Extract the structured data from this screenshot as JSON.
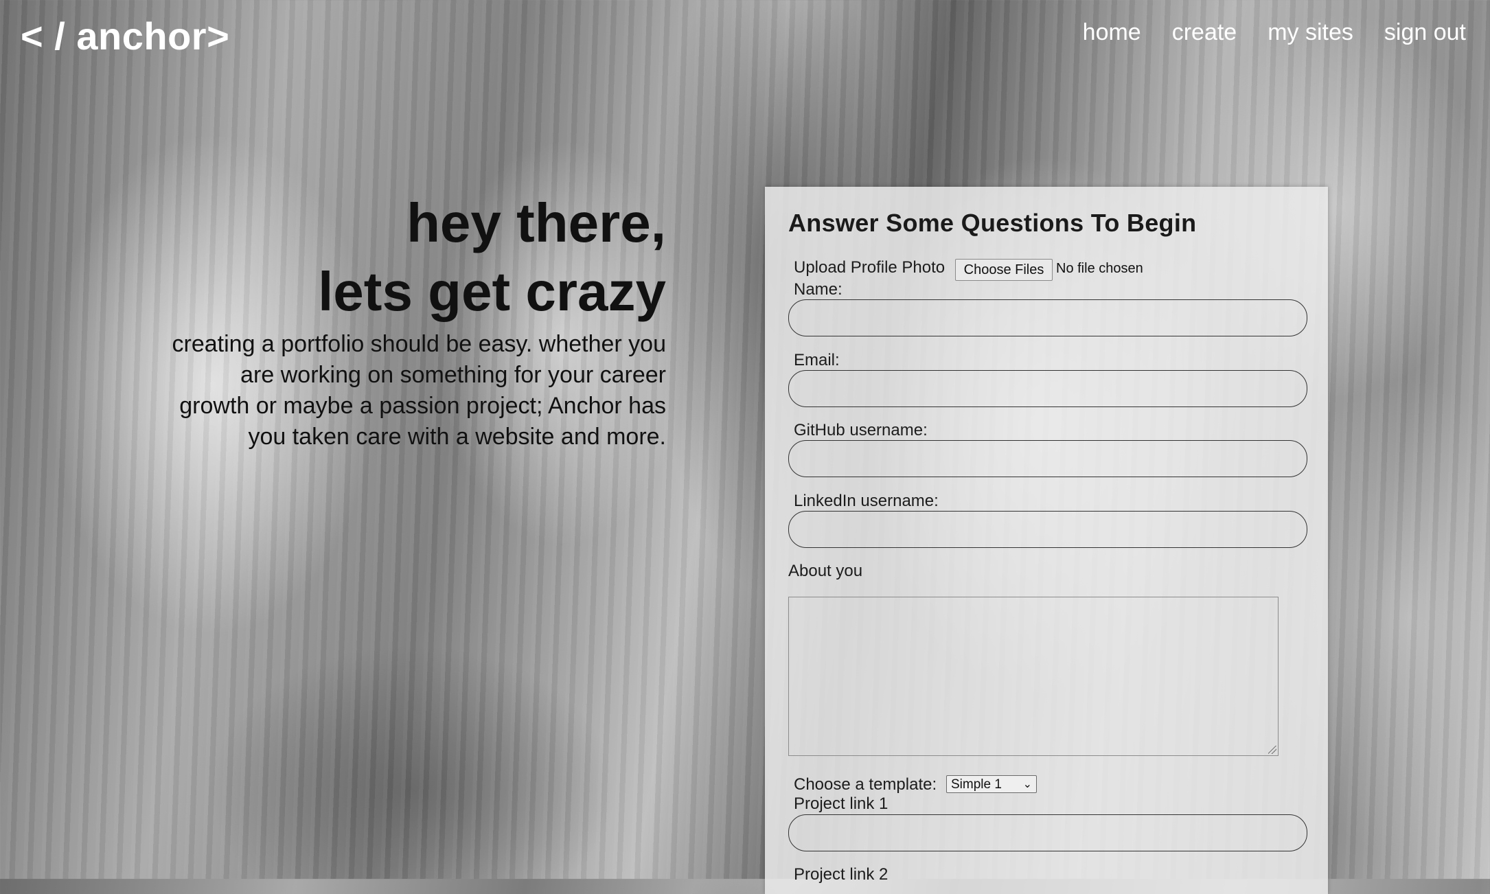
{
  "nav": {
    "logo": "< / anchor>",
    "links": [
      "home",
      "create",
      "my sites",
      "sign out"
    ]
  },
  "hero": {
    "line1": "hey there,",
    "line2": "lets get crazy",
    "body": "creating a portfolio should be easy. whether you are working on something for your career growth or maybe a passion project; Anchor has you taken care with a website and more."
  },
  "form": {
    "title": "Answer Some Questions To Begin",
    "photo_label": "Upload Profile Photo",
    "file_button": "Choose Files",
    "file_status": "No file chosen",
    "name_label": "Name:",
    "name_value": "",
    "email_label": "Email:",
    "email_value": "",
    "github_label": "GitHub username:",
    "github_value": "",
    "linkedin_label": "LinkedIn username:",
    "linkedin_value": "",
    "about_label": "About you",
    "about_value": "",
    "template_label": "Choose a template:",
    "template_selected": "Simple 1",
    "project1_label": "Project link 1",
    "project1_value": "",
    "project2_label": "Project link 2"
  },
  "icons": {
    "select_chevron": "chevron-down-icon"
  }
}
